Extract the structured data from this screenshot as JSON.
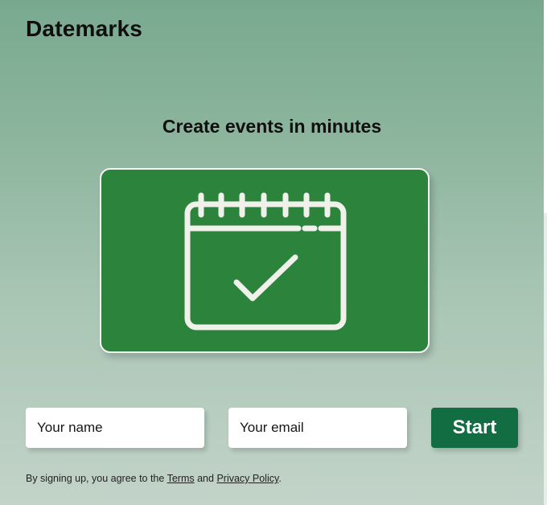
{
  "app": {
    "brand": "Datemarks"
  },
  "hero": {
    "headline": "Create events in minutes",
    "illustration_icon": "calendar-check-icon",
    "card_color": "#2b833c"
  },
  "signup_form": {
    "name_placeholder": "Your name",
    "email_placeholder": "Your email",
    "start_label": "Start",
    "button_color": "#136d43"
  },
  "legal": {
    "prefix": "By signing up, you agree to the ",
    "terms_label": "Terms",
    "conjunction": " and ",
    "privacy_label": "Privacy Policy",
    "suffix": "."
  }
}
